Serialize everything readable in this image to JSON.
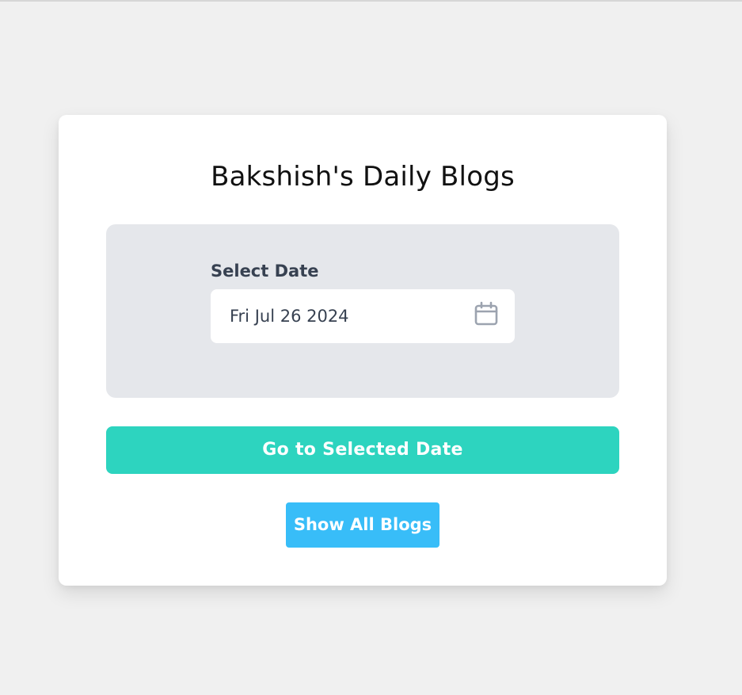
{
  "page": {
    "title": "Bakshish's Daily Blogs"
  },
  "date_picker": {
    "label": "Select Date",
    "value": "Fri Jul 26 2024",
    "icon": "calendar-icon"
  },
  "actions": {
    "go_label": "Go to Selected Date",
    "show_all_label": "Show All Blogs"
  },
  "colors": {
    "background": "#f0f0f0",
    "card": "#ffffff",
    "panel": "#e5e7eb",
    "go_button": "#2dd4bf",
    "show_button": "#38bdf8",
    "label_text": "#374151"
  }
}
